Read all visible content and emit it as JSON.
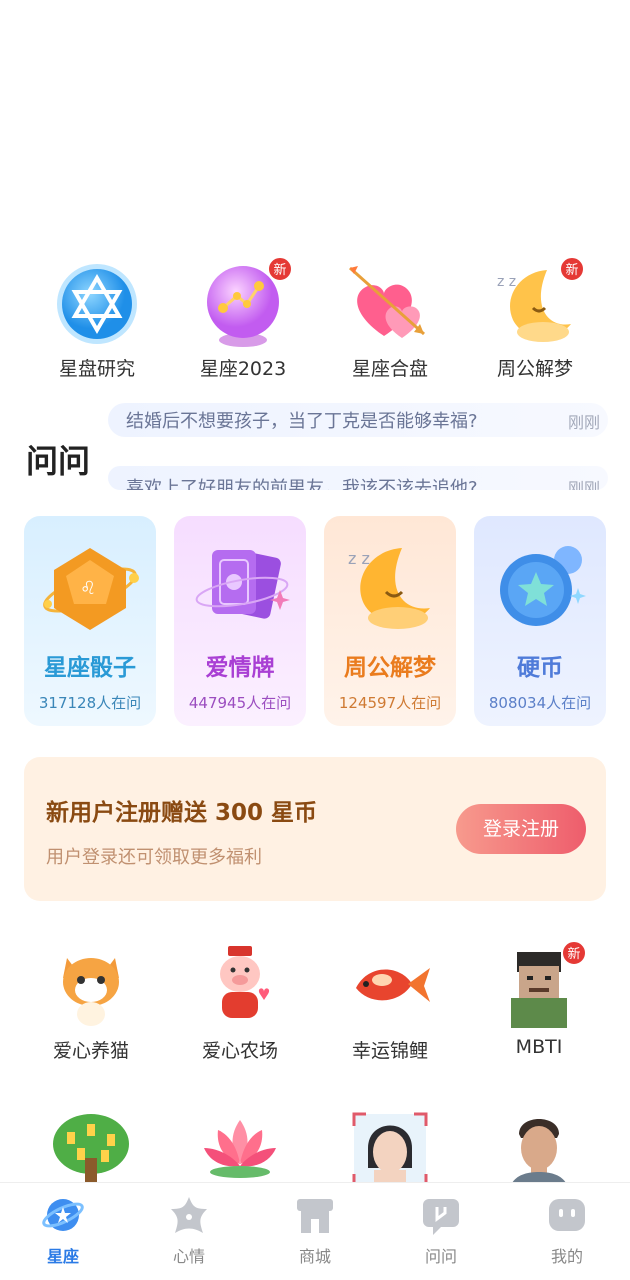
{
  "top_features": [
    {
      "label": "星盘研究",
      "icon": "hexagram-icon",
      "is_new": false
    },
    {
      "label": "星座2023",
      "icon": "crystal-ball-icon",
      "is_new": true
    },
    {
      "label": "星座合盘",
      "icon": "hearts-arrow-icon",
      "is_new": false
    },
    {
      "label": "周公解梦",
      "icon": "sleeping-moon-icon",
      "is_new": true
    }
  ],
  "new_badge": "新",
  "ask": {
    "title": "问问",
    "questions": [
      {
        "text": "结婚后不想要孩子，当了丁克是否能够幸福?",
        "time": "刚刚"
      },
      {
        "text": "喜欢上了好朋友的前男友，我该不该去追他?",
        "time": "刚刚"
      }
    ]
  },
  "cards": [
    {
      "name": "星座骰子",
      "count": "317128人在问",
      "icon": "dice-icon"
    },
    {
      "name": "爱情牌",
      "count": "447945人在问",
      "icon": "tarot-cards-icon"
    },
    {
      "name": "周公解梦",
      "count": "124597人在问",
      "icon": "sleeping-moon-icon"
    },
    {
      "name": "硬币",
      "count": "808034人在问",
      "icon": "coin-icon"
    }
  ],
  "banner": {
    "title": "新用户注册赠送 300 星币",
    "subtitle": "用户登录还可领取更多福利",
    "button": "登录注册"
  },
  "games": [
    {
      "label": "爱心养猫",
      "icon": "cat-icon",
      "is_new": false
    },
    {
      "label": "爱心农场",
      "icon": "pig-icon",
      "is_new": false
    },
    {
      "label": "幸运锦鲤",
      "icon": "koi-fish-icon",
      "is_new": false
    },
    {
      "label": "MBTI",
      "icon": "character-avatar-icon",
      "is_new": true
    },
    {
      "label": "",
      "icon": "money-tree-icon",
      "is_new": false
    },
    {
      "label": "",
      "icon": "lotus-icon",
      "is_new": false
    },
    {
      "label": "",
      "icon": "face-scan-icon",
      "is_new": false
    },
    {
      "label": "",
      "icon": "man-portrait-icon",
      "is_new": false
    }
  ],
  "tabs": [
    {
      "label": "星座",
      "icon": "planet-icon",
      "active": true
    },
    {
      "label": "心情",
      "icon": "star-shape-icon",
      "active": false
    },
    {
      "label": "商城",
      "icon": "shop-icon",
      "active": false
    },
    {
      "label": "问问",
      "icon": "chat-bubble-icon",
      "active": false
    },
    {
      "label": "我的",
      "icon": "profile-face-icon",
      "active": false
    }
  ],
  "colors": {
    "accent_blue": "#2b7be6",
    "badge_red": "#e53935",
    "banner_bg": "#fff1e3",
    "banner_title": "#8a4a12",
    "button_gradient_end": "#ee5d6c"
  }
}
